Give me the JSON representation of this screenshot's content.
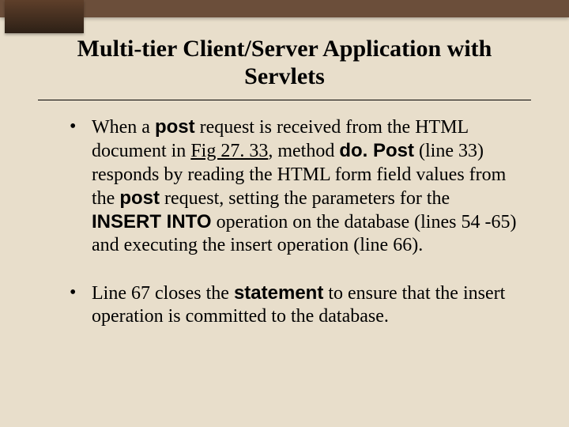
{
  "title": "Multi-tier Client/Server Application with Servlets",
  "bullets": {
    "b1": {
      "t1": "When a ",
      "bold1": "post",
      "t2": " request is received from the HTML document in ",
      "link": "Fig 27. 33",
      "t3": ", method ",
      "bold2": "do. Post",
      "t4": " (line 33) responds by reading the HTML form field values from the ",
      "bold3": "post",
      "t5": " request, setting the parameters for the ",
      "bold4": "INSERT INTO",
      "t6": " operation on the database (lines 54 -65) and executing the insert operation (line 66)."
    },
    "b2": {
      "t1": "Line 67 closes the ",
      "bold1": "statement",
      "t2": " to ensure that the insert operation is committed to the database."
    }
  }
}
